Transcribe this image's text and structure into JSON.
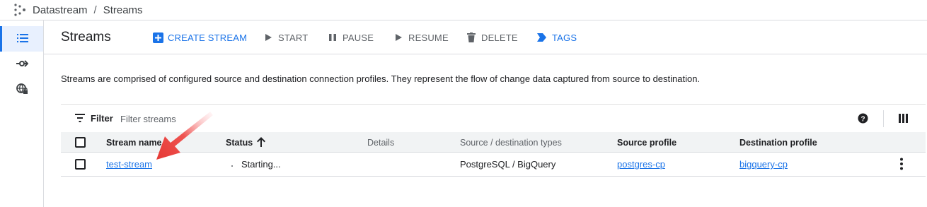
{
  "breadcrumb": {
    "product": "Datastream",
    "separator": "/",
    "page": "Streams"
  },
  "sidebar": {
    "items": [
      {
        "icon": "list-icon",
        "active": true
      },
      {
        "icon": "connection-profile-icon",
        "active": false
      },
      {
        "icon": "private-connectivity-icon",
        "active": false
      }
    ]
  },
  "toolbar": {
    "title": "Streams",
    "create_label": "CREATE STREAM",
    "start_label": "START",
    "pause_label": "PAUSE",
    "resume_label": "RESUME",
    "delete_label": "DELETE",
    "tags_label": "TAGS"
  },
  "description": "Streams are comprised of configured source and destination connection profiles. They represent the flow of change data captured from source to destination.",
  "filter": {
    "label": "Filter",
    "placeholder": "Filter streams"
  },
  "table": {
    "columns": [
      "Stream name",
      "Status",
      "Details",
      "Source / destination types",
      "Source profile",
      "Destination profile"
    ],
    "rows": [
      {
        "name": "test-stream",
        "status": "Starting...",
        "details": "",
        "types": "PostgreSQL / BigQuery",
        "source_profile": "postgres-cp",
        "destination_profile": "bigquery-cp"
      }
    ]
  },
  "colors": {
    "accent": "#1a73e8",
    "annotation_arrow": "#e53935"
  }
}
